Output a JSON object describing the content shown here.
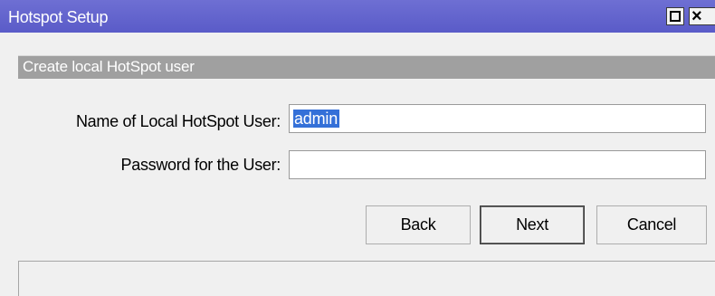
{
  "window": {
    "title": "Hotspot Setup",
    "maximize_icon": "maximize-icon",
    "close_icon": "close-icon",
    "close_glyph": "✕"
  },
  "section": {
    "header": "Create local HotSpot user"
  },
  "form": {
    "user_label": "Name of Local HotSpot User:",
    "user_value": "admin",
    "password_label": "Password for the User:",
    "password_value": ""
  },
  "buttons": {
    "back": "Back",
    "next": "Next",
    "cancel": "Cancel"
  },
  "status": {
    "text": ""
  },
  "colors": {
    "titlebar": "#5a5bc8",
    "section_header": "#a0a0a0",
    "selection": "#3470d8"
  }
}
